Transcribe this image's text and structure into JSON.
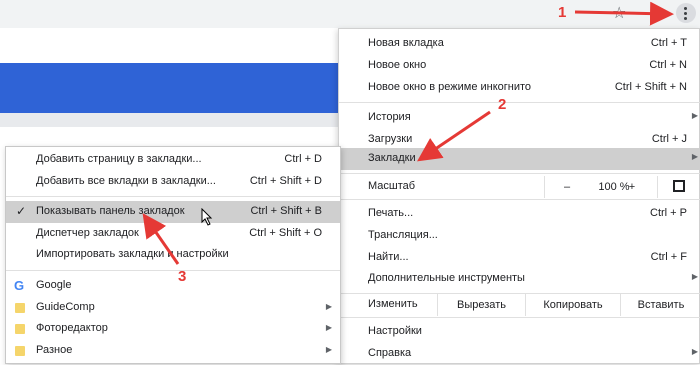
{
  "main_menu": {
    "items": [
      {
        "label": "Новая вкладка",
        "shortcut": "Ctrl + T"
      },
      {
        "label": "Новое окно",
        "shortcut": "Ctrl + N"
      },
      {
        "label": "Новое окно в режиме инкогнито",
        "shortcut": "Ctrl + Shift + N"
      },
      {
        "label": "История",
        "shortcut": ""
      },
      {
        "label": "Загрузки",
        "shortcut": "Ctrl + J"
      },
      {
        "label": "Закладки",
        "shortcut": ""
      },
      {
        "label": "Печать...",
        "shortcut": "Ctrl + P"
      },
      {
        "label": "Трансляция...",
        "shortcut": ""
      },
      {
        "label": "Найти...",
        "shortcut": "Ctrl + F"
      },
      {
        "label": "Дополнительные инструменты",
        "shortcut": ""
      },
      {
        "label": "Настройки",
        "shortcut": ""
      },
      {
        "label": "Справка",
        "shortcut": ""
      }
    ],
    "zoom": {
      "label": "Масштаб",
      "minus": "–",
      "value": "100 %",
      "plus": "+"
    },
    "edit": {
      "label": "Изменить",
      "cut": "Вырезать",
      "copy": "Копировать",
      "paste": "Вставить"
    }
  },
  "bookmarks_menu": {
    "items": [
      {
        "label": "Добавить страницу в закладки...",
        "shortcut": "Ctrl + D"
      },
      {
        "label": "Добавить все вкладки в закладки...",
        "shortcut": "Ctrl + Shift + D"
      },
      {
        "label": "Показывать панель закладок",
        "shortcut": "Ctrl + Shift + B",
        "checked": "✓"
      },
      {
        "label": "Диспетчер закладок",
        "shortcut": "Ctrl + Shift + O"
      },
      {
        "label": "Импортировать закладки и настройки",
        "shortcut": ""
      }
    ],
    "bookmarks": [
      {
        "label": "Google",
        "icon": "google-icon"
      },
      {
        "label": "GuideComp",
        "icon": "folder-icon"
      },
      {
        "label": "Фоторедактор",
        "icon": "folder-icon"
      },
      {
        "label": "Разное",
        "icon": "folder-icon"
      }
    ]
  },
  "annotations": {
    "step1": "1",
    "step2": "2",
    "step3": "3"
  },
  "colors": {
    "accent_red": "#e53935",
    "highlight": "#cfcfcf",
    "page_blue": "#2f63d6"
  }
}
